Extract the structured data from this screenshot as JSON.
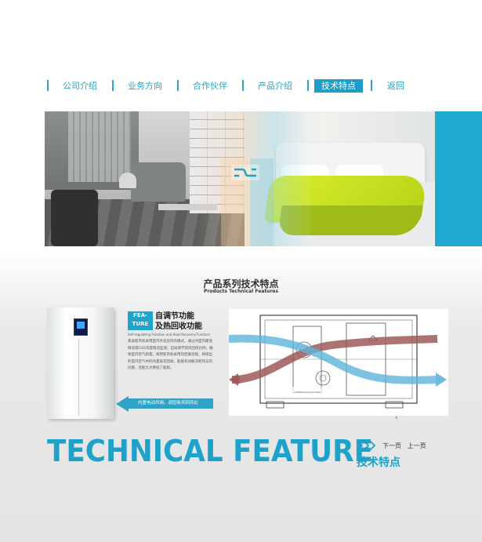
{
  "nav": {
    "items": [
      {
        "label": "公司介绍",
        "active": false
      },
      {
        "label": "业务方向",
        "active": false
      },
      {
        "label": "合作伙伴",
        "active": false
      },
      {
        "label": "产品介绍",
        "active": false
      },
      {
        "label": "技术特点",
        "active": true
      },
      {
        "label": "返回",
        "active": false
      }
    ]
  },
  "section": {
    "title": "产品系列技术特点",
    "subtitle": "Products Technical Features"
  },
  "feature": {
    "tag_line1": "FEA-",
    "tag_line2": "TURE",
    "title_line1": "自调节功能",
    "title_line2": "及热回收功能",
    "english": "Self-regulating Function and Heat Recovery Function",
    "desc": "家居新风机采用室内外混合风的模式，通过对室内最湿情况或CO2浓度情况监测，自动调节新风回风比例，确保室内空气质量。商用新风机采用热回收功能，将排出的室内空气中的热量再次回收，能能有效解决新风与热问题，还能大大降低了能耗。",
    "arrow_label": "内置电动风阀，调控新风回风比"
  },
  "diagram": {
    "label": "热回收装置，吸收排风热量"
  },
  "footer": {
    "big_title": "TECHNICAL FEATURE",
    "next": "下一页",
    "prev": "上一页",
    "cn_title": "技术特点"
  },
  "colors": {
    "accent": "#1ea2c9",
    "warm_air": "#9e5a5a",
    "fresh_air": "#5fb4db"
  }
}
